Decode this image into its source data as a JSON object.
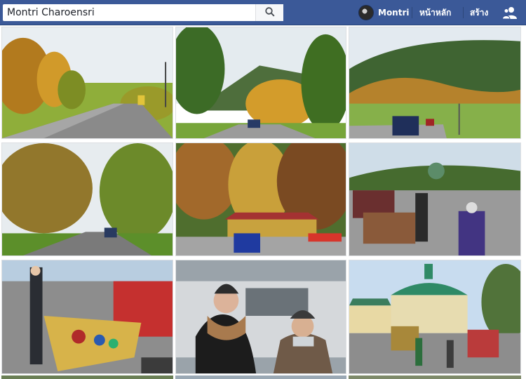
{
  "search": {
    "value": "Montri Charoensri",
    "placeholder": "Search"
  },
  "user": {
    "name": "Montri"
  },
  "nav": {
    "home": "หน้าหลัก",
    "create": "สร้าง"
  },
  "icons": {
    "search": "search-icon",
    "friends": "friend-requests-icon"
  },
  "colors": {
    "brand": "#3b5998",
    "brand_dark": "#29487d",
    "page_bg": "#e9ebee"
  },
  "photos": [
    {
      "subject": "autumn-road-yellow-trees"
    },
    {
      "subject": "road-through-autumn-forest-hills"
    },
    {
      "subject": "cars-on-road-mountain-valley"
    },
    {
      "subject": "road-under-autumn-trees"
    },
    {
      "subject": "autumn-forest-house-blue-car"
    },
    {
      "subject": "outdoor-flea-market-visitors"
    },
    {
      "subject": "flea-market-toys-table"
    },
    {
      "subject": "woman-and-man-by-car"
    },
    {
      "subject": "green-dome-building-market"
    }
  ]
}
